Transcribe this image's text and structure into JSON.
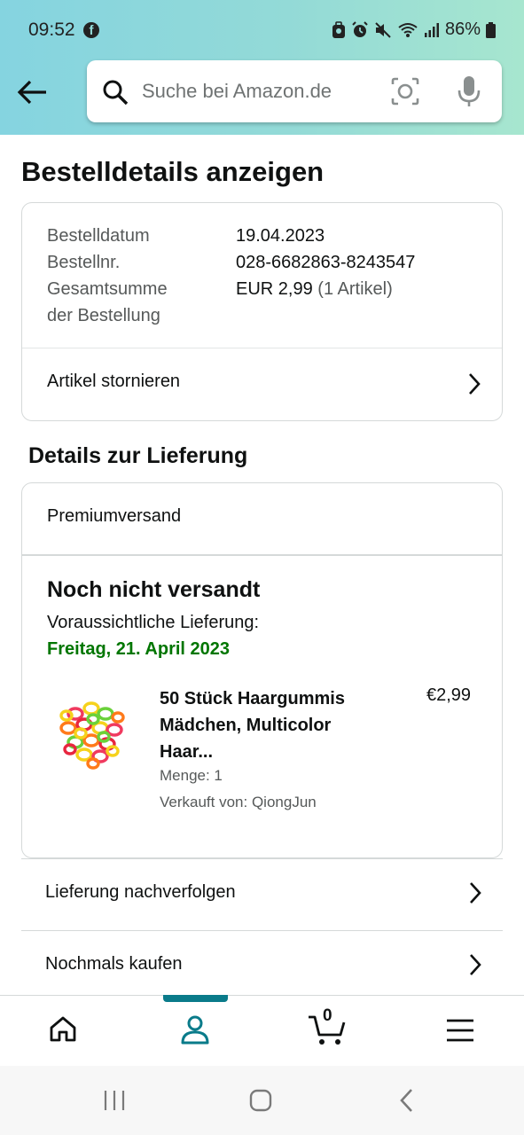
{
  "status_bar": {
    "time": "09:52",
    "battery": "86%"
  },
  "search": {
    "placeholder": "Suche bei Amazon.de"
  },
  "page": {
    "title": "Bestelldetails anzeigen"
  },
  "order": {
    "date_label": "Bestelldatum",
    "date_value": "19.04.2023",
    "number_label": "Bestellnr.",
    "number_value": "028-6682863-8243547",
    "total_label_line1": "Gesamtsumme",
    "total_label_line2": "der Bestellung",
    "total_value": "EUR 2,99",
    "total_items": "(1 Artikel)",
    "cancel_label": "Artikel stornieren"
  },
  "delivery": {
    "section_title": "Details zur Lieferung",
    "shipping_method": "Premiumversand",
    "status": "Noch nicht versandt",
    "eta_label": "Voraussichtliche Lieferung:",
    "eta_date": "Freitag, 21. April 2023",
    "product": {
      "title_line1": "50 Stück Haargummis",
      "title_line2": "Mädchen, Multicolor",
      "title_line3": "Haar...",
      "price": "€2,99",
      "quantity": "Menge: 1",
      "seller": "Verkauft von: QiongJun"
    }
  },
  "actions": {
    "track": "Lieferung nachverfolgen",
    "buy_again": "Nochmals kaufen"
  },
  "bottom_nav": {
    "cart_count": "0",
    "items": [
      "home-icon",
      "account-icon",
      "cart-icon",
      "menu-icon"
    ],
    "active": "account-icon"
  },
  "colors": {
    "accent": "#0a7b8a",
    "eta": "#007600",
    "header_start": "#85d4e0",
    "header_end": "#a7e6cf"
  }
}
